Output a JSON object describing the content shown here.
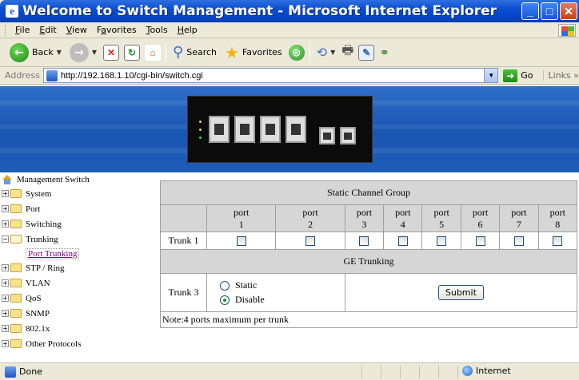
{
  "window": {
    "title": "Welcome to Switch Management - Microsoft Internet Explorer",
    "app_icon": "ie-page-icon",
    "controls": [
      "minimize",
      "maximize",
      "close"
    ]
  },
  "menubar": {
    "items": [
      {
        "label": "File",
        "accel": "F"
      },
      {
        "label": "Edit",
        "accel": "E"
      },
      {
        "label": "View",
        "accel": "V"
      },
      {
        "label": "Favorites",
        "accel": "a"
      },
      {
        "label": "Tools",
        "accel": "T"
      },
      {
        "label": "Help",
        "accel": "H"
      }
    ]
  },
  "toolbar": {
    "back_label": "Back",
    "search_label": "Search",
    "favorites_label": "Favorites"
  },
  "address": {
    "label": "Address",
    "url": "http://192.168.1.10/cgi-bin/switch.cgi",
    "go_label": "Go",
    "links_label": "Links"
  },
  "sidebar": {
    "root_label": "Management Switch",
    "items": [
      {
        "label": "System",
        "expanded": false
      },
      {
        "label": "Port",
        "expanded": false
      },
      {
        "label": "Switching",
        "expanded": false
      },
      {
        "label": "Trunking",
        "expanded": true
      },
      {
        "label": "STP / Ring",
        "expanded": false
      },
      {
        "label": "VLAN",
        "expanded": false
      },
      {
        "label": "QoS",
        "expanded": false
      },
      {
        "label": "SNMP",
        "expanded": false
      },
      {
        "label": "802.1x",
        "expanded": false
      },
      {
        "label": "Other Protocols",
        "expanded": false
      }
    ],
    "sub_item": "Port Trunking"
  },
  "static_group": {
    "title": "Static Channel Group",
    "ports": [
      {
        "word": "port",
        "num": "1"
      },
      {
        "word": "port",
        "num": "2"
      },
      {
        "word": "port",
        "num": "3"
      },
      {
        "word": "port",
        "num": "4"
      },
      {
        "word": "port",
        "num": "5"
      },
      {
        "word": "port",
        "num": "6"
      },
      {
        "word": "port",
        "num": "7"
      },
      {
        "word": "port",
        "num": "8"
      }
    ],
    "trunk_label": "Trunk 1",
    "checked": [
      false,
      false,
      false,
      false,
      false,
      false,
      false,
      false
    ]
  },
  "ge_trunking": {
    "title": "GE Trunking",
    "trunk_label": "Trunk 3",
    "options": [
      "Static",
      "Disable"
    ],
    "selected": "Disable",
    "submit_label": "Submit"
  },
  "note": "Note:4 ports maximum per trunk",
  "status": {
    "text": "Done",
    "zone": "Internet"
  },
  "colors": {
    "titlebar": "#0a4fd1",
    "banner": "#1a56b3",
    "table_header": "#d6d6d6",
    "visited_link": "#800080"
  }
}
